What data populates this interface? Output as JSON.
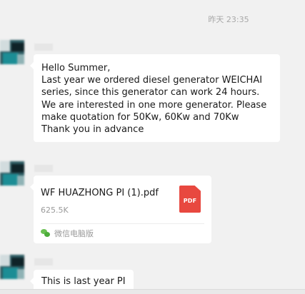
{
  "chat": {
    "timestamp": "昨天 23:35",
    "messages": [
      {
        "type": "text",
        "lines": [
          "Hello Summer,",
          "Last year we ordered diesel generator WEICHAI",
          "series, since this generator can work 24 hours.",
          "We are interested in one more generator. Please",
          "make quotation for 50Kw, 60Kw and 70Kw",
          "Thank you in advance"
        ]
      },
      {
        "type": "file",
        "file_name": "WF HUAZHONG PI (1).pdf",
        "file_size": "625.5K",
        "file_type_label": "PDF",
        "file_icon": "pdf-file-icon",
        "source_icon": "wechat-icon",
        "source_label": "微信电脑版"
      },
      {
        "type": "text",
        "text": "This is last year PI"
      }
    ]
  },
  "colors": {
    "background": "#f1f1f1",
    "bubble": "#ffffff",
    "pdf_red": "#e8483f",
    "wechat_green": "#4dad3b"
  }
}
